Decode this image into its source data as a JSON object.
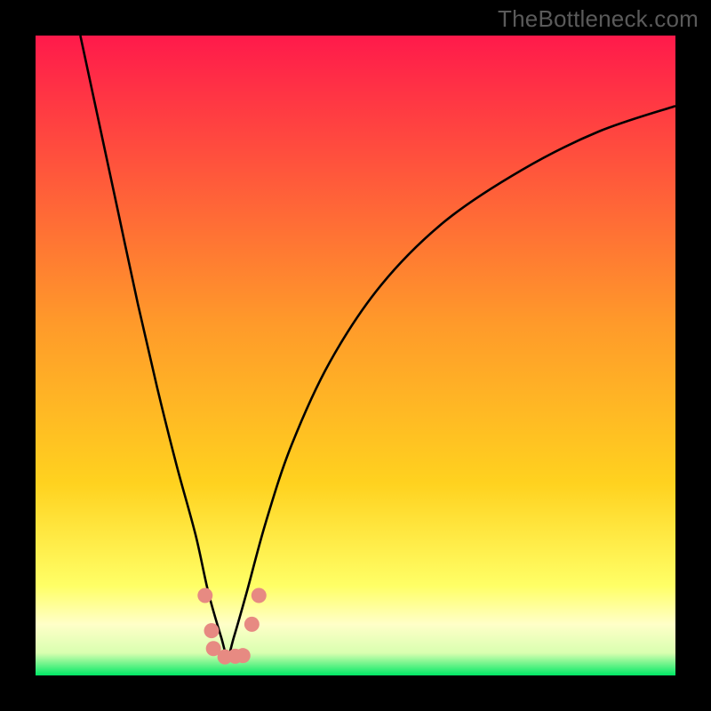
{
  "watermark": "TheBottleneck.com",
  "colors": {
    "frame": "#000000",
    "gradient_top": "#ff1a4b",
    "gradient_mid1": "#ff7a2a",
    "gradient_mid2": "#ffd21f",
    "gradient_low": "#ffff66",
    "gradient_pale": "#ffffb8",
    "gradient_bottom": "#00e865",
    "curve": "#000000",
    "marker": "#e78a82"
  },
  "chart_data": {
    "type": "line",
    "title": "",
    "xlabel": "",
    "ylabel": "",
    "xlim": [
      0,
      100
    ],
    "ylim": [
      0,
      100
    ],
    "optimum_x": 30,
    "series": [
      {
        "name": "bottleneck-curve",
        "x": [
          7,
          10,
          13,
          16,
          19,
          22,
          25,
          27,
          29,
          30,
          31,
          33,
          36,
          40,
          46,
          54,
          64,
          76,
          88,
          100
        ],
        "y": [
          100,
          86,
          72,
          58,
          45,
          33,
          22,
          13,
          6,
          3,
          6,
          13,
          24,
          36,
          49,
          61,
          71,
          79,
          85,
          89
        ]
      }
    ],
    "markers": [
      {
        "x": 26.5,
        "y": 12.5
      },
      {
        "x": 27.5,
        "y": 7.0
      },
      {
        "x": 27.8,
        "y": 4.2
      },
      {
        "x": 29.6,
        "y": 2.9
      },
      {
        "x": 31.2,
        "y": 3.0
      },
      {
        "x": 32.4,
        "y": 3.1
      },
      {
        "x": 33.8,
        "y": 8.0
      },
      {
        "x": 34.9,
        "y": 12.5
      }
    ],
    "gradient_stops": [
      {
        "pct": 0,
        "level": "high"
      },
      {
        "pct": 45,
        "level": "mid-high"
      },
      {
        "pct": 70,
        "level": "mid"
      },
      {
        "pct": 86,
        "level": "low"
      },
      {
        "pct": 94,
        "level": "very-low"
      },
      {
        "pct": 100,
        "level": "optimal"
      }
    ]
  }
}
